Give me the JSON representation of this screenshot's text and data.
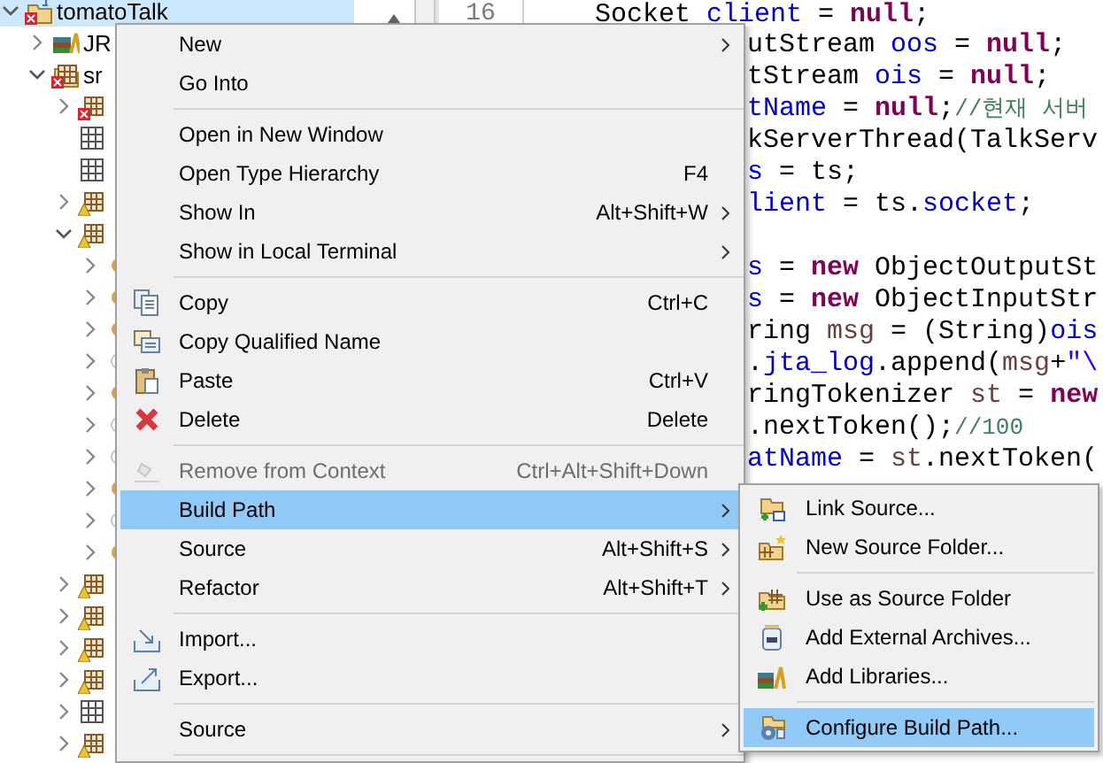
{
  "explorer": {
    "tree": [
      {
        "label": "tomatoTalk",
        "kind": "project-error",
        "expanded": true,
        "selected": true,
        "children": [
          {
            "label": "JR",
            "kind": "library",
            "expanded": false,
            "selected": false
          },
          {
            "label": "sr",
            "kind": "source-folder-error",
            "expanded": true,
            "selected": false,
            "children": [
              {
                "kind": "package-error",
                "expanded": false,
                "selected": false
              },
              {
                "kind": "package",
                "selected": false
              },
              {
                "kind": "package",
                "selected": false
              },
              {
                "kind": "package-warning",
                "expanded": false,
                "selected": false
              },
              {
                "kind": "package-warning",
                "expanded": true,
                "selected": false,
                "children": [
                  {
                    "kind": "java-file-warning",
                    "expanded": false,
                    "selected": false
                  },
                  {
                    "kind": "java-file-warning",
                    "expanded": false,
                    "selected": false
                  },
                  {
                    "kind": "java-file-warning",
                    "expanded": false,
                    "selected": false
                  },
                  {
                    "kind": "java-file",
                    "expanded": false,
                    "selected": false
                  },
                  {
                    "kind": "java-file-warning",
                    "expanded": false,
                    "selected": false
                  },
                  {
                    "kind": "java-file",
                    "expanded": false,
                    "selected": false
                  },
                  {
                    "kind": "java-file",
                    "expanded": false,
                    "selected": false
                  },
                  {
                    "kind": "java-file-warning",
                    "expanded": false,
                    "selected": false
                  },
                  {
                    "kind": "java-file",
                    "expanded": false,
                    "selected": false
                  },
                  {
                    "kind": "java-file-warning",
                    "expanded": false,
                    "selected": false
                  }
                ]
              },
              {
                "kind": "package-warning",
                "expanded": false,
                "selected": false
              },
              {
                "kind": "package-warning",
                "expanded": false,
                "selected": false
              },
              {
                "kind": "package-warning",
                "expanded": false,
                "selected": false
              },
              {
                "kind": "package-warning",
                "expanded": false,
                "selected": false
              },
              {
                "kind": "package",
                "expanded": false,
                "selected": false
              },
              {
                "kind": "package-warning",
                "expanded": false,
                "selected": false
              }
            ]
          }
        ]
      }
    ]
  },
  "editor": {
    "line_number": "16",
    "lines": [
      {
        "kind": "code",
        "segments": [
          {
            "kind": "plain",
            "text": "Socket "
          },
          {
            "kind": "field",
            "text": "client"
          },
          {
            "kind": "plain",
            "text": " = "
          },
          {
            "kind": "keyword",
            "text": "null"
          },
          {
            "kind": "plain",
            "text": ";"
          }
        ]
      },
      {
        "kind": "code",
        "segments": [
          {
            "kind": "plain",
            "text": "utStream "
          },
          {
            "kind": "field",
            "text": "oos"
          },
          {
            "kind": "plain",
            "text": " = "
          },
          {
            "kind": "keyword",
            "text": "null"
          },
          {
            "kind": "plain",
            "text": ";"
          }
        ]
      },
      {
        "kind": "code",
        "segments": [
          {
            "kind": "plain",
            "text": "tStream "
          },
          {
            "kind": "field",
            "text": "ois"
          },
          {
            "kind": "plain",
            "text": " = "
          },
          {
            "kind": "keyword",
            "text": "null"
          },
          {
            "kind": "plain",
            "text": ";"
          }
        ]
      },
      {
        "kind": "code",
        "segments": [
          {
            "kind": "field",
            "text": "tName"
          },
          {
            "kind": "plain",
            "text": " = "
          },
          {
            "kind": "keyword",
            "text": "null"
          },
          {
            "kind": "plain",
            "text": ";"
          },
          {
            "kind": "comment",
            "text": "//현재 서버"
          }
        ]
      },
      {
        "kind": "code",
        "segments": [
          {
            "kind": "plain",
            "text": "kServerThread(TalkServ"
          }
        ]
      },
      {
        "kind": "code",
        "segments": [
          {
            "kind": "field",
            "text": "s"
          },
          {
            "kind": "plain",
            "text": " = ts;"
          }
        ]
      },
      {
        "kind": "code",
        "segments": [
          {
            "kind": "field",
            "text": "lient"
          },
          {
            "kind": "plain",
            "text": " = ts."
          },
          {
            "kind": "field",
            "text": "socket"
          },
          {
            "kind": "plain",
            "text": ";"
          }
        ]
      },
      {
        "kind": "blank"
      },
      {
        "kind": "code",
        "segments": [
          {
            "kind": "field",
            "text": "s"
          },
          {
            "kind": "plain",
            "text": " = "
          },
          {
            "kind": "keyword",
            "text": "new"
          },
          {
            "kind": "plain",
            "text": " ObjectOutputSt"
          }
        ]
      },
      {
        "kind": "code",
        "segments": [
          {
            "kind": "field",
            "text": "s"
          },
          {
            "kind": "plain",
            "text": " = "
          },
          {
            "kind": "keyword",
            "text": "new"
          },
          {
            "kind": "plain",
            "text": " ObjectInputStr"
          }
        ]
      },
      {
        "kind": "code",
        "segments": [
          {
            "kind": "plain",
            "text": "ring "
          },
          {
            "kind": "local",
            "text": "msg"
          },
          {
            "kind": "plain",
            "text": " = (String)"
          },
          {
            "kind": "field",
            "text": "ois"
          }
        ]
      },
      {
        "kind": "code",
        "segments": [
          {
            "kind": "plain",
            "text": "."
          },
          {
            "kind": "field",
            "text": "jta_log"
          },
          {
            "kind": "plain",
            "text": ".append("
          },
          {
            "kind": "local",
            "text": "msg"
          },
          {
            "kind": "plain",
            "text": "+"
          },
          {
            "kind": "string",
            "text": "\"\\"
          }
        ]
      },
      {
        "kind": "code",
        "segments": [
          {
            "kind": "plain",
            "text": "ringTokenizer "
          },
          {
            "kind": "local",
            "text": "st"
          },
          {
            "kind": "plain",
            "text": " = "
          },
          {
            "kind": "keyword",
            "text": "new"
          }
        ]
      },
      {
        "kind": "code",
        "segments": [
          {
            "kind": "plain",
            "text": ".nextToken();"
          },
          {
            "kind": "comment",
            "text": "//100"
          }
        ]
      },
      {
        "kind": "code",
        "segments": [
          {
            "kind": "field",
            "text": "atName"
          },
          {
            "kind": "plain",
            "text": " = "
          },
          {
            "kind": "local",
            "text": "st"
          },
          {
            "kind": "plain",
            "text": ".nextToken("
          }
        ]
      }
    ]
  },
  "context_menu": {
    "items": [
      {
        "kind": "item",
        "label": "New",
        "submenu": true,
        "disabled": false,
        "selected": false
      },
      {
        "kind": "item",
        "label": "Go Into",
        "submenu": false,
        "disabled": false,
        "selected": false
      },
      {
        "kind": "separator"
      },
      {
        "kind": "item",
        "label": "Open in New Window",
        "submenu": false,
        "disabled": false,
        "selected": false
      },
      {
        "kind": "item",
        "label": "Open Type Hierarchy",
        "shortcut": "F4",
        "submenu": false,
        "disabled": false,
        "selected": false
      },
      {
        "kind": "item",
        "label": "Show In",
        "shortcut": "Alt+Shift+W",
        "submenu": true,
        "disabled": false,
        "selected": false
      },
      {
        "kind": "item",
        "label": "Show in Local Terminal",
        "submenu": true,
        "disabled": false,
        "selected": false
      },
      {
        "kind": "separator"
      },
      {
        "kind": "copy",
        "label": "Copy",
        "shortcut": "Ctrl+C",
        "submenu": false,
        "disabled": false,
        "selected": false
      },
      {
        "kind": "copy-qualified",
        "label": "Copy Qualified Name",
        "submenu": false,
        "disabled": false,
        "selected": false
      },
      {
        "kind": "paste",
        "label": "Paste",
        "shortcut": "Ctrl+V",
        "submenu": false,
        "disabled": false,
        "selected": false
      },
      {
        "kind": "delete",
        "label": "Delete",
        "shortcut": "Delete",
        "submenu": false,
        "disabled": false,
        "selected": false
      },
      {
        "kind": "separator"
      },
      {
        "kind": "remove-context",
        "label": "Remove from Context",
        "shortcut": "Ctrl+Alt+Shift+Down",
        "submenu": false,
        "disabled": true,
        "selected": false
      },
      {
        "kind": "item",
        "label": "Build Path",
        "submenu": true,
        "disabled": false,
        "selected": true
      },
      {
        "kind": "item",
        "label": "Source",
        "shortcut": "Alt+Shift+S",
        "submenu": true,
        "disabled": false,
        "selected": false
      },
      {
        "kind": "item",
        "label": "Refactor",
        "shortcut": "Alt+Shift+T",
        "submenu": true,
        "disabled": false,
        "selected": false
      },
      {
        "kind": "separator"
      },
      {
        "kind": "import",
        "label": "Import...",
        "submenu": false,
        "disabled": false,
        "selected": false
      },
      {
        "kind": "export",
        "label": "Export...",
        "submenu": false,
        "disabled": false,
        "selected": false
      },
      {
        "kind": "separator"
      },
      {
        "kind": "item",
        "label": "Source",
        "submenu": true,
        "disabled": false,
        "selected": false
      },
      {
        "kind": "separator"
      }
    ]
  },
  "submenu": {
    "items": [
      {
        "kind": "link-source",
        "label": "Link Source...",
        "selected": false
      },
      {
        "kind": "new-source-folder",
        "label": "New Source Folder...",
        "selected": false
      },
      {
        "kind": "separator"
      },
      {
        "kind": "use-as-source",
        "label": "Use as Source Folder",
        "selected": false
      },
      {
        "kind": "add-archives",
        "label": "Add External Archives...",
        "selected": false
      },
      {
        "kind": "add-libraries",
        "label": "Add Libraries...",
        "selected": false
      },
      {
        "kind": "separator"
      },
      {
        "kind": "configure",
        "label": "Configure Build Path...",
        "selected": true
      }
    ]
  }
}
